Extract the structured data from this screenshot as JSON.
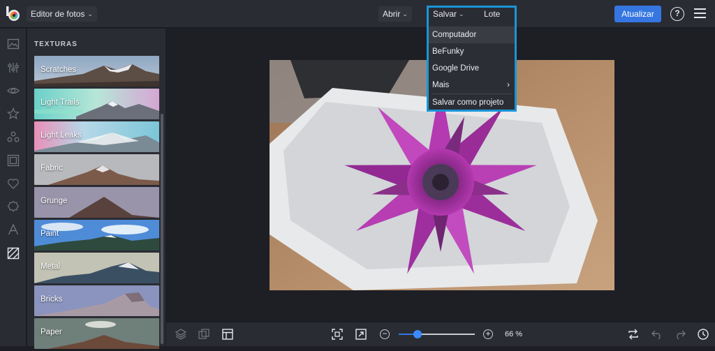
{
  "header": {
    "app_menu_label": "Editor de fotos",
    "open_label": "Abrir",
    "save_label": "Salvar",
    "batch_label": "Lote",
    "update_label": "Atualizar",
    "help_label": "?"
  },
  "save_menu": {
    "items": [
      {
        "label": "Computador",
        "icon": ""
      },
      {
        "label": "BeFunky",
        "icon": ""
      },
      {
        "label": "Google Drive",
        "icon": ""
      },
      {
        "label": "Mais",
        "icon": "›"
      },
      {
        "label": "Salvar como projeto",
        "icon": ""
      }
    ]
  },
  "sidebar": {
    "tools": [
      "image-icon",
      "sliders-icon",
      "eye-icon",
      "star-icon",
      "shapes-icon",
      "frame-icon",
      "heart-icon",
      "badge-icon",
      "text-icon",
      "texture-icon"
    ]
  },
  "panel": {
    "title": "TEXTURAS",
    "textures": [
      {
        "label": "Scratches"
      },
      {
        "label": "Light Trails"
      },
      {
        "label": "Light Leaks"
      },
      {
        "label": "Fabric"
      },
      {
        "label": "Grunge"
      },
      {
        "label": "Paint"
      },
      {
        "label": "Metal"
      },
      {
        "label": "Bricks"
      },
      {
        "label": "Paper"
      }
    ]
  },
  "footer": {
    "zoom_value": "66 %",
    "zoom_level": 0.25
  },
  "colors": {
    "accent": "#3576e0",
    "highlight": "#1a95d8"
  }
}
